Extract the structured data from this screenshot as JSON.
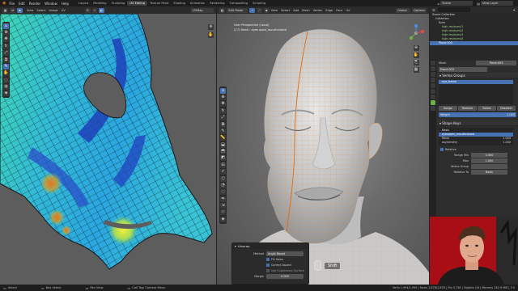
{
  "topbar": {
    "menus": [
      "File",
      "Edit",
      "Render",
      "Window",
      "Help"
    ],
    "tabs": [
      {
        "label": "Layout",
        "active": false
      },
      {
        "label": "Modeling",
        "active": false
      },
      {
        "label": "Sculpting",
        "active": false
      },
      {
        "label": "UV Editing",
        "active": true
      },
      {
        "label": "Texture Paint",
        "active": false
      },
      {
        "label": "Shading",
        "active": false
      },
      {
        "label": "Animation",
        "active": false
      },
      {
        "label": "Rendering",
        "active": false
      },
      {
        "label": "Compositing",
        "active": false
      },
      {
        "label": "Scripting",
        "active": false
      }
    ],
    "scene_label": "Scene",
    "view_layer_label": "View Layer"
  },
  "uv_editor": {
    "header_items": [
      "UV Editor",
      "View",
      "Select",
      "Image",
      "UV"
    ],
    "uvmap_label": "UVMap"
  },
  "viewport": {
    "mode": "Edit Mode",
    "header_items": [
      "View",
      "Select",
      "Add",
      "Mesh",
      "Vertex",
      "Edge",
      "Face",
      "UV"
    ],
    "transform": "Global",
    "info_line1": "User Perspective (Local)",
    "info_line2": "(17) Mesh : eyes open_mouthclosed",
    "options_label": "Options"
  },
  "outliner": {
    "title": "Scene Collection",
    "items": [
      "Collection",
      "Eyes",
      "high-res/eyes/1",
      "high-res/eyes/2",
      "high-res/eyes/3",
      "high-res/eyes/4",
      "Plane.003"
    ]
  },
  "properties": {
    "object_name": "Plane.003",
    "mesh_label": "Mesh",
    "vertex_groups_title": "Vertex Groups",
    "vertex_groups": [
      "eye_frame"
    ],
    "vg_buttons": [
      "Assign",
      "Remove",
      "Select",
      "Deselect"
    ],
    "weight_label": "Weight",
    "weight_value": "1.000",
    "shape_keys_title": "Shape Keys",
    "shape_keys": [
      {
        "name": "Basis",
        "value": ""
      },
      {
        "name": "eyesopen_mouthclosed",
        "value": ""
      },
      {
        "name": "Relax",
        "value": "1.000"
      },
      {
        "name": "asymmetry",
        "value": "1.000"
      }
    ],
    "relative_label": "Relative",
    "range_min_label": "Range Min",
    "range_min_value": "0.000",
    "max_label": "Max",
    "max_value": "1.000",
    "vertex_group_label": "Vertex Group",
    "relative_to_label": "Relative To",
    "relative_to_value": "Basis"
  },
  "unwrap_panel": {
    "title": "Unwrap",
    "method_label": "Method",
    "method_value": "Angle Based",
    "fill_holes": "Fill Holes",
    "correct_aspect": "Correct Aspect",
    "use_subsurf": "Use Subdivision Surface",
    "margin_label": "Margin",
    "margin_value": "0.000"
  },
  "key_overlay": "Shift",
  "statusbar": {
    "items": [
      "Select",
      "Box Select",
      "Pan View",
      "Call Tool Context Menu"
    ],
    "stats": "Verts 1,994/1,994 | Faces 1,878/1,878 | Tris 3,748 | Objects 1/4 | Memory 342.9 MiB | 3.0"
  },
  "colors": {
    "accent": "#4772b3",
    "wire": "#f08d2c",
    "webcam_bg": "#a80f14"
  }
}
